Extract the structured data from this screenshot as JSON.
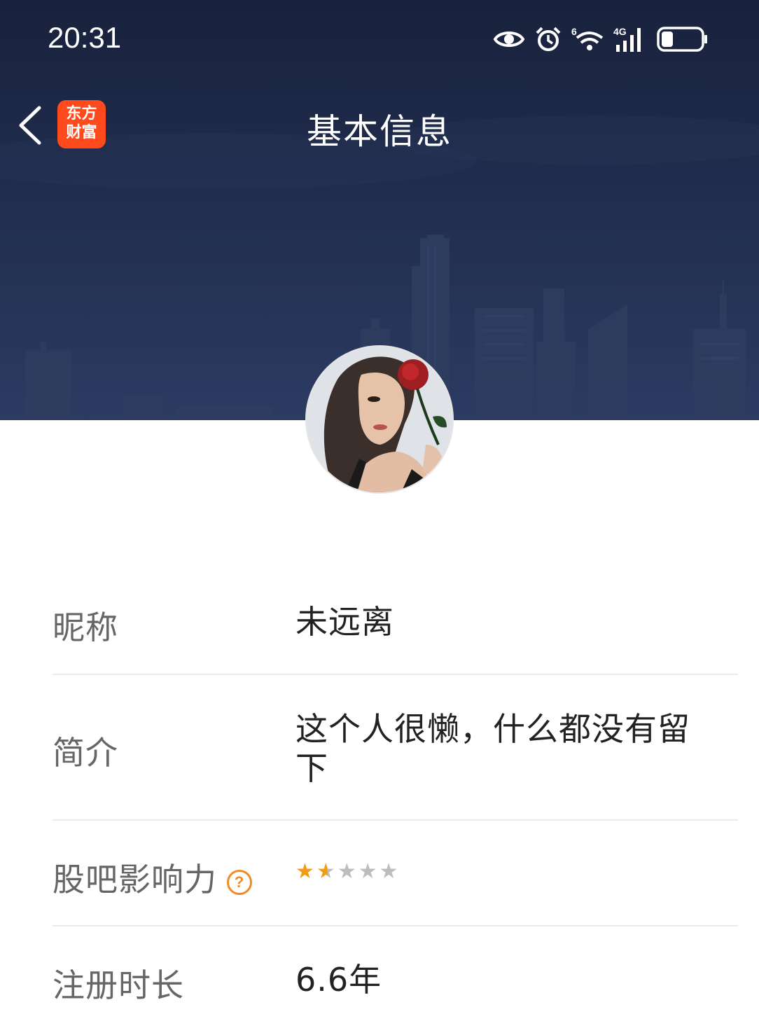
{
  "status_bar": {
    "time": "20:31",
    "icons": [
      "eye-icon",
      "alarm-icon",
      "wifi-6-icon",
      "signal-4g-icon",
      "battery-icon"
    ],
    "wifi_badge": "6",
    "network_label": "4G",
    "battery_level": 0.3
  },
  "nav": {
    "title": "基本信息",
    "logo_line1": "东方",
    "logo_line2": "财富",
    "logo_color": "#ff4a1e"
  },
  "profile": {
    "rows": [
      {
        "label": "昵称",
        "value": "未远离"
      },
      {
        "label": "简介",
        "value": "这个人很懒，什么都没有留下"
      },
      {
        "label": "股吧影响力",
        "help_symbol": "?",
        "rating": 1.5,
        "rating_max": 5
      },
      {
        "label": "注册时长",
        "value": "6.6年"
      }
    ]
  },
  "colors": {
    "banner": "#1e2a4a",
    "star_active": "#f39c12",
    "star_inactive": "#bdbdbd",
    "help_icon": "#f08c28"
  }
}
